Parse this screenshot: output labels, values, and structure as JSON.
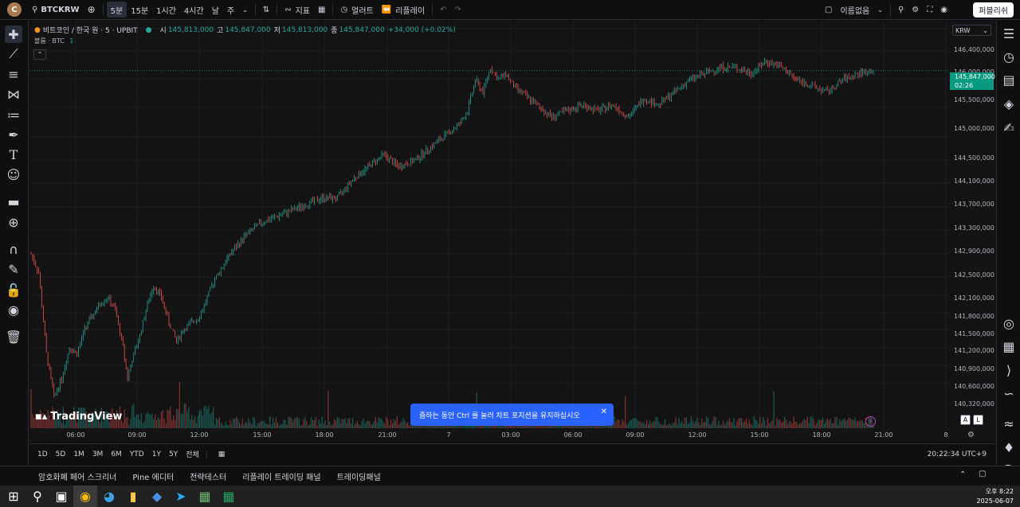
{
  "topbar": {
    "avatar_letter": "C",
    "symbol": "BTCKRW",
    "intervals": [
      "5분",
      "15분",
      "1시간",
      "4시간",
      "날",
      "주"
    ],
    "active_interval": "5분",
    "indicators_label": "지표",
    "alert_label": "얼러트",
    "replay_label": "리플레이",
    "layout_name": "이름없음",
    "publish_label": "퍼블리쉬"
  },
  "legend": {
    "title": "비트코인 / 한국 원 · 5 · UPBIT",
    "o_label": "시",
    "o": "145,813,000",
    "h_label": "고",
    "h": "145,847,000",
    "l_label": "저",
    "l": "145,813,000",
    "c_label": "종",
    "c": "145,847,000",
    "change": "+34,000 (+0.02%)",
    "volume_indicator": "볼륨 · BTC",
    "volume_value": "1"
  },
  "price_axis": {
    "currency": "KRW",
    "ticks": [
      "146,400,000",
      "146,000,000",
      "145,500,000",
      "145,000,000",
      "144,500,000",
      "144,100,000",
      "143,700,000",
      "143,300,000",
      "142,900,000",
      "142,500,000",
      "142,100,000",
      "141,800,000",
      "141,500,000",
      "141,200,000",
      "140,900,000",
      "140,600,000",
      "140,320,000"
    ],
    "current_price": "145,847,000",
    "countdown": "02:26"
  },
  "time_axis": {
    "ticks": [
      "06:00",
      "09:00",
      "12:00",
      "15:00",
      "18:00",
      "21:00",
      "7",
      "03:00",
      "06:00",
      "09:00",
      "12:00",
      "15:00",
      "18:00",
      "21:00",
      "8"
    ]
  },
  "range_bar": {
    "ranges": [
      "1D",
      "5D",
      "1M",
      "3M",
      "6M",
      "YTD",
      "1Y",
      "5Y",
      "전체"
    ],
    "time": "20:22:34 UTC+9"
  },
  "bottom_tabs": [
    "암호화폐 페어 스크리너",
    "Pine 에디터",
    "전략테스터",
    "리플레이 트레이딩 패널",
    "트레이딩패널"
  ],
  "toast": {
    "text": "줌하는 동안 Ctrl 를 눌러 차트 포지션을 유지하십시오"
  },
  "logo_text": "TradingView",
  "scale_buttons": [
    "A",
    "L"
  ],
  "taskbar": {
    "time": "오후 8:22",
    "date": "2025-06-07"
  },
  "colors": {
    "up": "#26a69a",
    "down": "#ef5350",
    "accent": "#2962ff"
  },
  "chart_data": {
    "type": "candlestick",
    "ylim": [
      140100000,
      146650000
    ],
    "points": [
      [
        0,
        142900000
      ],
      [
        5,
        142600000
      ],
      [
        10,
        141300000
      ],
      [
        15,
        140600000
      ],
      [
        20,
        140900000
      ],
      [
        25,
        141400000
      ],
      [
        30,
        141300000
      ],
      [
        35,
        141700000
      ],
      [
        40,
        141900000
      ],
      [
        45,
        142100000
      ],
      [
        50,
        142200000
      ],
      [
        55,
        142000000
      ],
      [
        60,
        141400000
      ],
      [
        63,
        140900000
      ],
      [
        66,
        141200000
      ],
      [
        70,
        141500000
      ],
      [
        75,
        142000000
      ],
      [
        80,
        142400000
      ],
      [
        85,
        142200000
      ],
      [
        90,
        141800000
      ],
      [
        95,
        141500000
      ],
      [
        100,
        141700000
      ],
      [
        110,
        141900000
      ],
      [
        120,
        142500000
      ],
      [
        130,
        142900000
      ],
      [
        140,
        143200000
      ],
      [
        150,
        143400000
      ],
      [
        160,
        143500000
      ],
      [
        170,
        143600000
      ],
      [
        180,
        143700000
      ],
      [
        190,
        143800000
      ],
      [
        200,
        143800000
      ],
      [
        210,
        144100000
      ],
      [
        220,
        144300000
      ],
      [
        230,
        144500000
      ],
      [
        240,
        144300000
      ],
      [
        250,
        144400000
      ],
      [
        260,
        144600000
      ],
      [
        270,
        144800000
      ],
      [
        280,
        145000000
      ],
      [
        285,
        145200000
      ],
      [
        290,
        145700000
      ],
      [
        295,
        145500000
      ],
      [
        300,
        145900000
      ],
      [
        305,
        145700000
      ],
      [
        310,
        145800000
      ],
      [
        315,
        145600000
      ],
      [
        320,
        145500000
      ],
      [
        330,
        145300000
      ],
      [
        340,
        145100000
      ],
      [
        350,
        145200000
      ],
      [
        360,
        145300000
      ],
      [
        370,
        145200000
      ],
      [
        380,
        145300000
      ],
      [
        390,
        145100000
      ],
      [
        400,
        145400000
      ],
      [
        410,
        145300000
      ],
      [
        420,
        145500000
      ],
      [
        430,
        145700000
      ],
      [
        440,
        145800000
      ],
      [
        450,
        145900000
      ],
      [
        460,
        145900000
      ],
      [
        470,
        145800000
      ],
      [
        480,
        146000000
      ],
      [
        490,
        145900000
      ],
      [
        500,
        145700000
      ],
      [
        510,
        145600000
      ],
      [
        520,
        145500000
      ],
      [
        530,
        145700000
      ],
      [
        540,
        145800000
      ],
      [
        550,
        145847000
      ]
    ]
  }
}
